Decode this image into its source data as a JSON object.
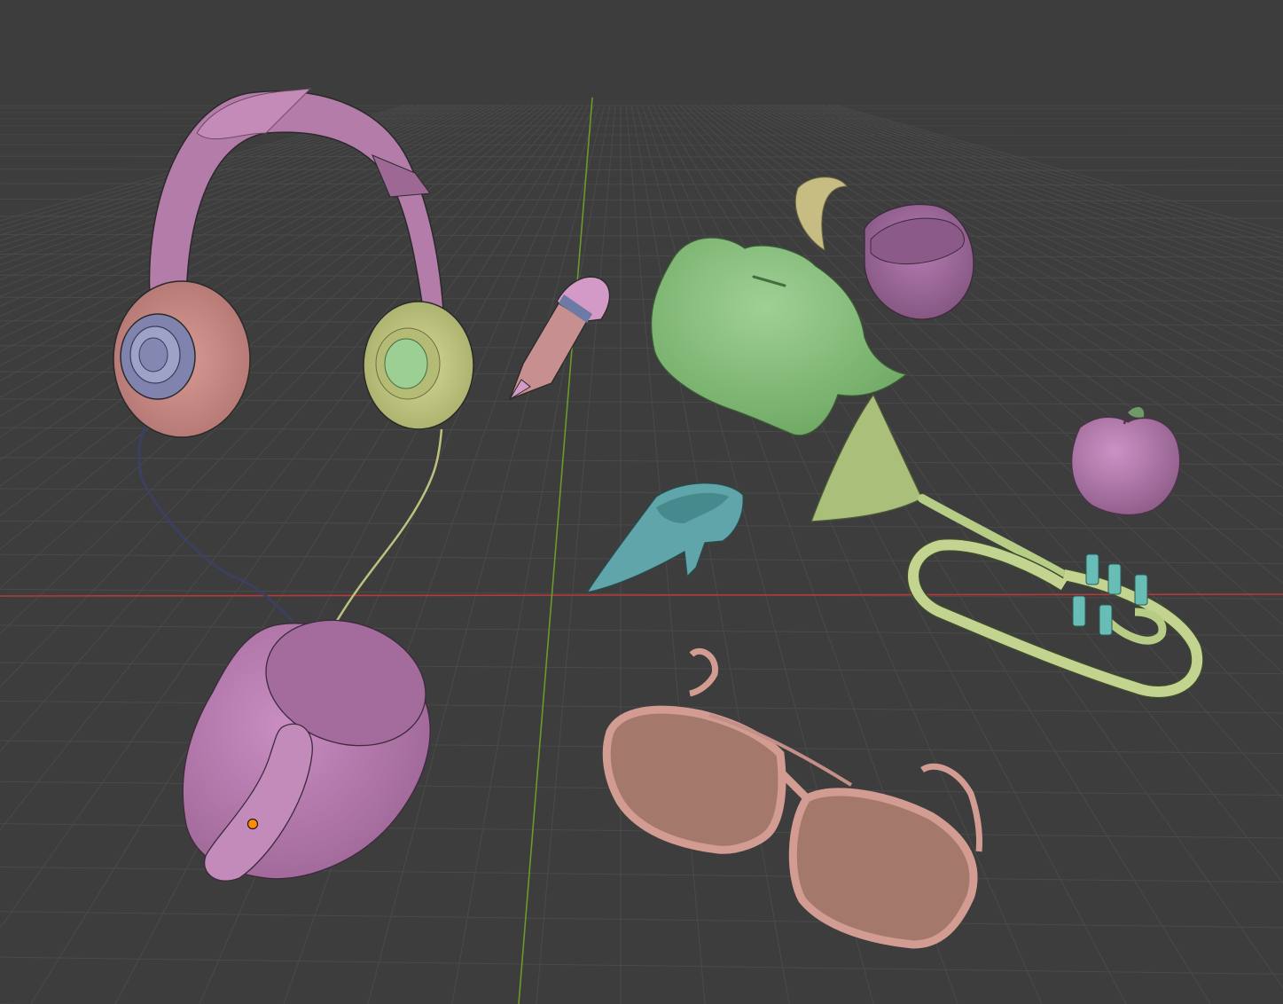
{
  "viewport": {
    "background": "#3d3d3d",
    "grid_color": "#4a4a4a",
    "grid_color_far": "#454545",
    "x_axis_color": "#b53a3a",
    "y_axis_color": "#6a9a2a",
    "origin_marker_color": "#ff8c00"
  },
  "objects": [
    {
      "name": "headphones",
      "color": "#c585b5",
      "accent": "#c7cf82",
      "cable": "#4a4f70"
    },
    {
      "name": "pencil",
      "color": "#c88f90",
      "accent": "#d49ac8"
    },
    {
      "name": "piggy-bank",
      "color": "#86bf7a"
    },
    {
      "name": "egg-shell",
      "color": "#a06aa0",
      "accent": "#c7bc82"
    },
    {
      "name": "apple",
      "color": "#b77fb2"
    },
    {
      "name": "high-heel-shoe",
      "color": "#5fa5a9"
    },
    {
      "name": "trumpet",
      "color": "#b7cc85",
      "accent": "#68bdb7"
    },
    {
      "name": "mug",
      "color": "#b67aae"
    },
    {
      "name": "sunglasses",
      "color": "#d29c92",
      "lens": "#a4786b"
    }
  ]
}
